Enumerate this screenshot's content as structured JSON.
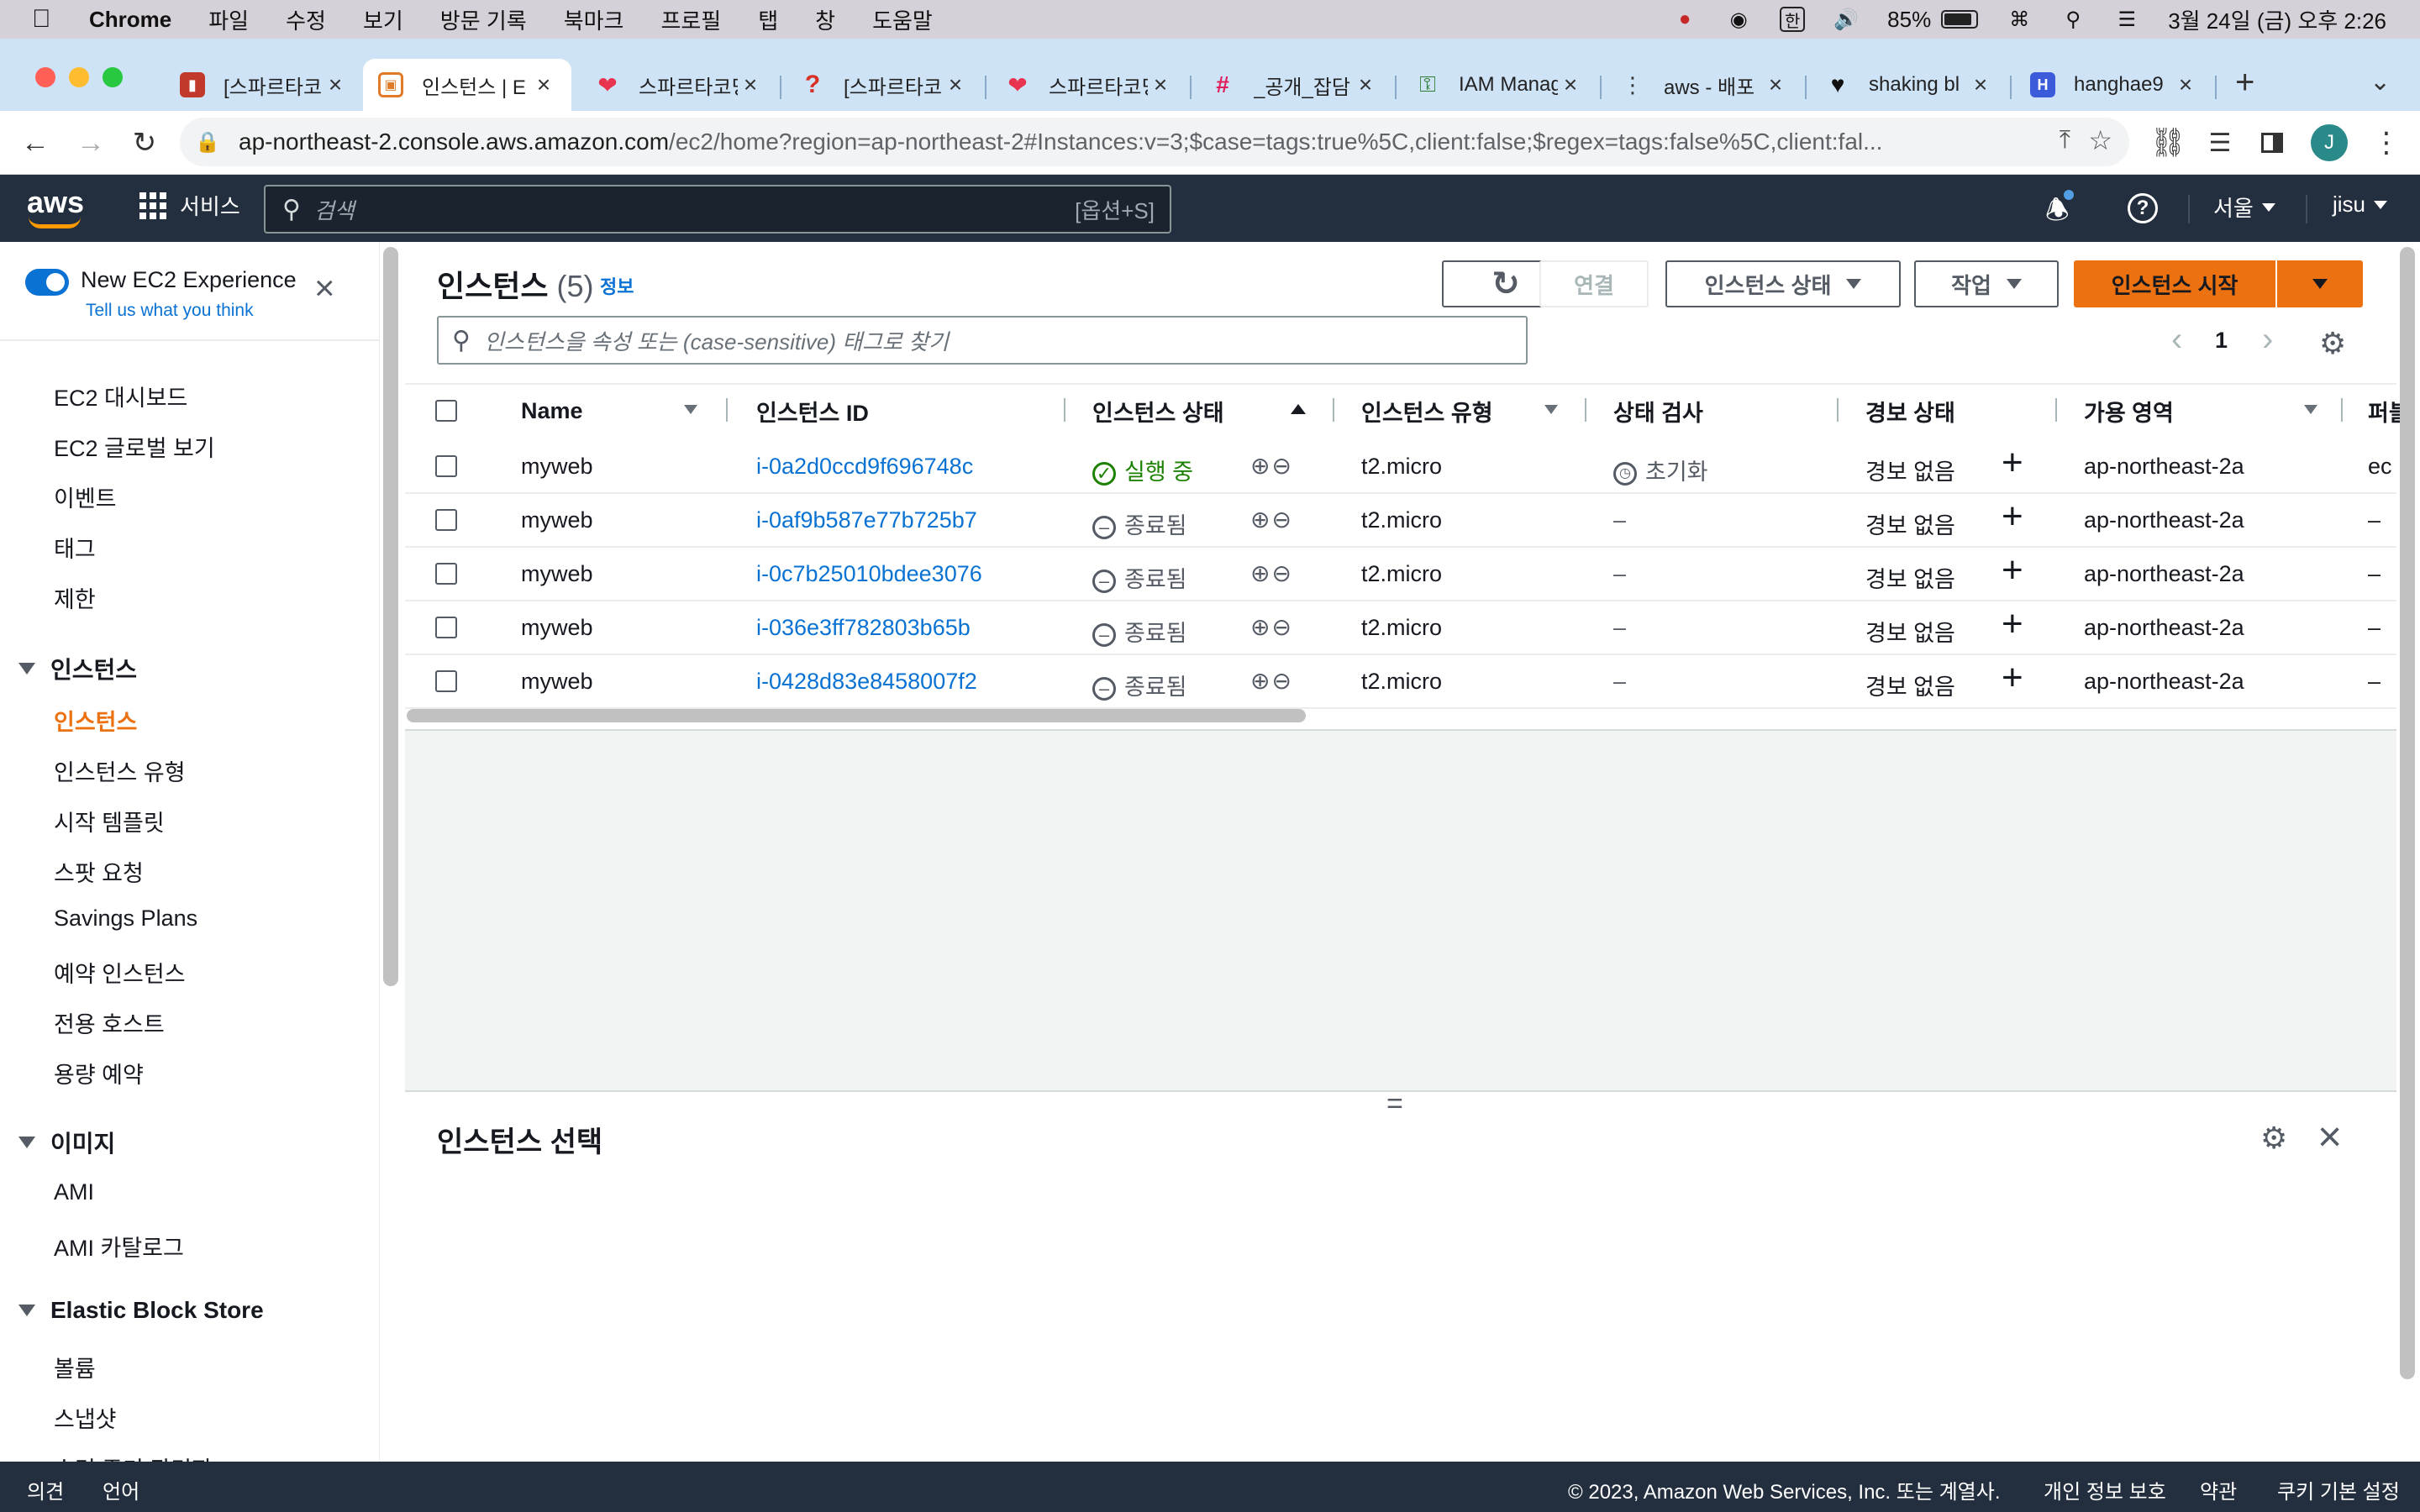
{
  "menubar": {
    "app": "Chrome",
    "items": [
      "파일",
      "수정",
      "보기",
      "방문 기록",
      "북마크",
      "프로필",
      "탭",
      "창",
      "도움말"
    ],
    "input_method": "한",
    "battery": "85%",
    "datetime": "3월 24일 (금) 오후 2:26"
  },
  "tabs": [
    {
      "title": "[스파르타코",
      "icon": "book-icon",
      "color": "#c0392b"
    },
    {
      "title": "인스턴스 | E",
      "icon": "ec2-icon",
      "color": "#e07b2a",
      "active": true
    },
    {
      "title": "스파르타코딩",
      "icon": "sparta-icon",
      "color": "#e8344e"
    },
    {
      "title": "[스파르타코",
      "icon": "question-icon",
      "color": "#d93025"
    },
    {
      "title": "스파르타코딩",
      "icon": "sparta-icon",
      "color": "#e8344e"
    },
    {
      "title": "_공개_잡담",
      "icon": "slack-icon",
      "color": "#4a154b"
    },
    {
      "title": "IAM Manag",
      "icon": "iam-icon",
      "color": "#2e7d32"
    },
    {
      "title": "aws - 배포",
      "icon": "dots-icon",
      "color": "#333333"
    },
    {
      "title": "shaking bl",
      "icon": "heart-icon",
      "color": "#111111"
    },
    {
      "title": "hanghae9",
      "icon": "h-icon",
      "color": "#3b5bdb"
    }
  ],
  "addressbar": {
    "host": "ap-northeast-2.console.aws.amazon.com",
    "path": "/ec2/home?region=ap-northeast-2#Instances:v=3;$case=tags:true%5C,client:false;$regex=tags:false%5C,client:fal...",
    "profile_initial": "J"
  },
  "aws_header": {
    "logo": "aws",
    "services": "서비스",
    "search_placeholder": "검색",
    "search_shortcut": "[옵션+S]",
    "region": "서울",
    "user": "jisu"
  },
  "sidebar": {
    "experience_label": "New EC2 Experience",
    "experience_link": "Tell us what you think",
    "top_items": [
      "EC2 대시보드",
      "EC2 글로벌 보기",
      "이벤트",
      "태그",
      "제한"
    ],
    "section_instances": "인스턴스",
    "instances_items": [
      "인스턴스",
      "인스턴스 유형",
      "시작 템플릿",
      "스팟 요청",
      "Savings Plans",
      "예약 인스턴스",
      "전용 호스트",
      "용량 예약"
    ],
    "section_images": "이미지",
    "images_items": [
      "AMI",
      "AMI 카탈로그"
    ],
    "section_ebs": "Elastic Block Store",
    "ebs_items": [
      "볼륨",
      "스냅샷",
      "수명 주기 관리자"
    ]
  },
  "main": {
    "title": "인스턴스",
    "count": "(5)",
    "info": "정보",
    "connect": "연결",
    "instance_state": "인스턴스 상태",
    "actions": "작업",
    "launch": "인스턴스 시작",
    "search_placeholder": "인스턴스을 속성 또는 (case-sensitive) 태그로 찾기",
    "page": "1",
    "columns": [
      "Name",
      "인스턴스 ID",
      "인스턴스 상태",
      "인스턴스 유형",
      "상태 검사",
      "경보 상태",
      "가용 영역",
      "퍼블"
    ],
    "rows": [
      {
        "name": "myweb",
        "id": "i-0a2d0ccd9f696748c",
        "state": "실행 중",
        "running": true,
        "type": "t2.micro",
        "check": "초기화",
        "alarm": "경보 없음",
        "az": "ap-northeast-2a",
        "extra": "ec"
      },
      {
        "name": "myweb",
        "id": "i-0af9b587e77b725b7",
        "state": "종료됨",
        "running": false,
        "type": "t2.micro",
        "check": "–",
        "alarm": "경보 없음",
        "az": "ap-northeast-2a",
        "extra": "–"
      },
      {
        "name": "myweb",
        "id": "i-0c7b25010bdee3076",
        "state": "종료됨",
        "running": false,
        "type": "t2.micro",
        "check": "–",
        "alarm": "경보 없음",
        "az": "ap-northeast-2a",
        "extra": "–"
      },
      {
        "name": "myweb",
        "id": "i-036e3ff782803b65b",
        "state": "종료됨",
        "running": false,
        "type": "t2.micro",
        "check": "–",
        "alarm": "경보 없음",
        "az": "ap-northeast-2a",
        "extra": "–"
      },
      {
        "name": "myweb",
        "id": "i-0428d83e8458007f2",
        "state": "종료됨",
        "running": false,
        "type": "t2.micro",
        "check": "–",
        "alarm": "경보 없음",
        "az": "ap-northeast-2a",
        "extra": "–"
      }
    ],
    "detail_title": "인스턴스 선택"
  },
  "footer": {
    "feedback": "의견",
    "language": "언어",
    "copyright": "© 2023, Amazon Web Services, Inc. 또는 계열사.",
    "privacy": "개인 정보 보호",
    "terms": "약관",
    "cookies": "쿠키 기본 설정"
  },
  "colors": {
    "aws_navy": "#232f3e",
    "aws_orange": "#ec7211",
    "link_blue": "#0972d3",
    "running_green": "#1d8102"
  }
}
